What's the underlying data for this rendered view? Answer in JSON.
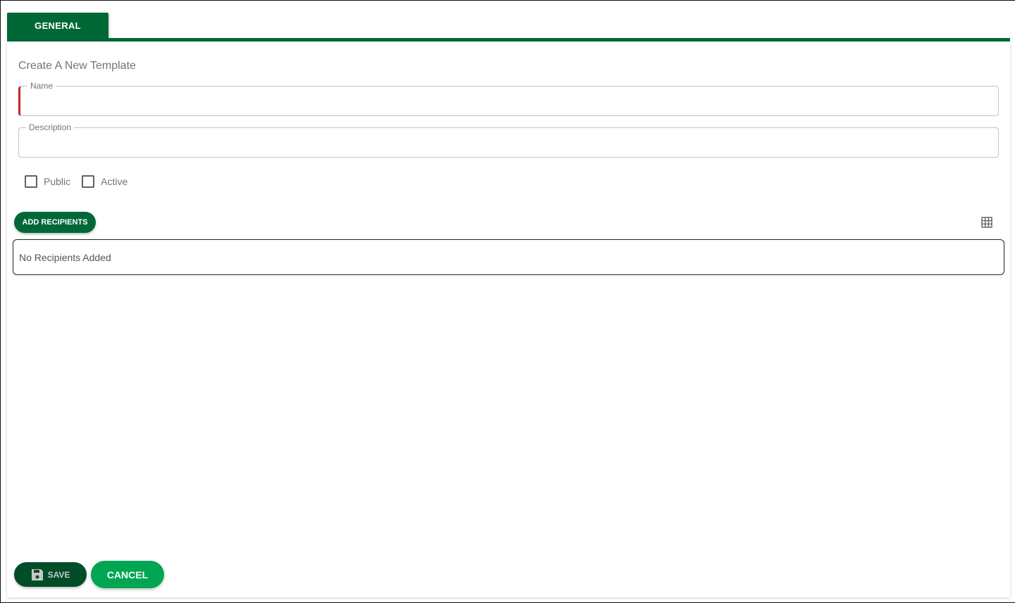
{
  "tabs": [
    {
      "label": "GENERAL",
      "active": true
    }
  ],
  "form": {
    "title": "Create A New Template",
    "name": {
      "label": "Name",
      "value": "",
      "required": true
    },
    "description": {
      "label": "Description",
      "value": ""
    },
    "checkboxes": [
      {
        "label": "Public",
        "checked": false
      },
      {
        "label": "Active",
        "checked": false
      }
    ]
  },
  "recipients": {
    "add_label": "ADD RECIPIENTS",
    "empty_text": "No Recipients Added",
    "view_icon": "grid-icon"
  },
  "footer": {
    "save_label": "SAVE",
    "save_icon": "floppy-disk-icon",
    "cancel_label": "CANCEL"
  },
  "colors": {
    "primary": "#006837",
    "save_bg": "#004d27",
    "cancel_bg": "#00a651",
    "required": "#c62828"
  }
}
